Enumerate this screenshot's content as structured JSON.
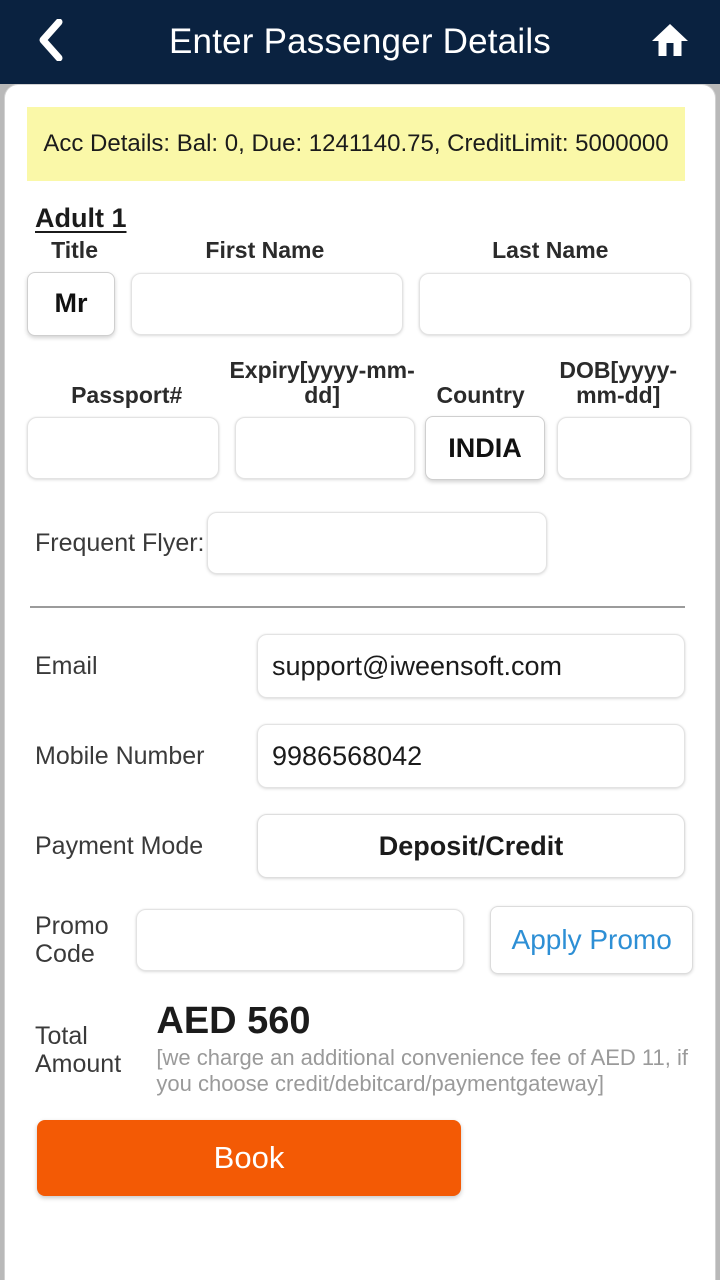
{
  "appbar": {
    "title": "Enter Passenger Details",
    "back_icon": "chevron-left-icon",
    "home_icon": "home-icon",
    "background": "#0a2240"
  },
  "account_banner": {
    "text": "Acc Details: Bal: 0, Due: 1241140.75, CreditLimit: 5000000",
    "background": "#faf8a8"
  },
  "passenger": {
    "group_label": "Adult 1",
    "labels": {
      "title": "Title",
      "first_name": "First Name",
      "last_name": "Last Name",
      "passport": "Passport#",
      "expiry": "Expiry[yyyy-mm-dd]",
      "country": "Country",
      "dob": "DOB[yyyy-mm-dd]",
      "frequent_flyer": "Frequent Flyer:"
    },
    "values": {
      "title": "Mr",
      "first_name": "",
      "last_name": "",
      "passport": "",
      "expiry": "",
      "country": "INDIA",
      "dob": "",
      "frequent_flyer": ""
    }
  },
  "contact": {
    "email_label": "Email",
    "email_value": "support@iweensoft.com",
    "mobile_label": "Mobile Number",
    "mobile_value": "9986568042",
    "payment_mode_label": "Payment Mode",
    "payment_mode_value": "Deposit/Credit"
  },
  "promo": {
    "label": "Promo Code",
    "value": "",
    "apply_label": "Apply Promo",
    "apply_color": "#2d8fd5"
  },
  "total": {
    "label": "Total Amount",
    "amount": "AED 560",
    "note": "[we charge an additional convenience fee of AED 11, if you choose credit/debitcard/paymentgateway]"
  },
  "book": {
    "label": "Book",
    "color": "#f35a05"
  }
}
